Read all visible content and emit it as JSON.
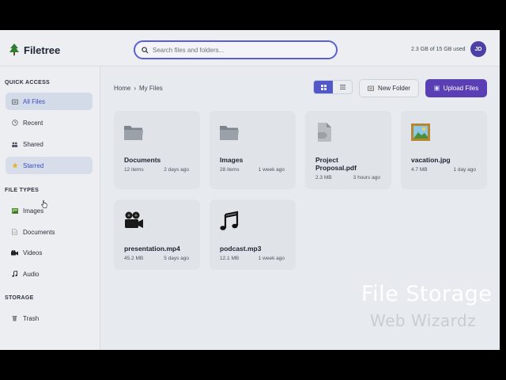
{
  "header": {
    "app_name": "Filetree",
    "search_placeholder": "Search files and folders...",
    "storage": "2.3 GB of 15 GB used",
    "avatar_initials": "JD"
  },
  "sidebar": {
    "quick_access_title": "QUICK ACCESS",
    "quick_access": [
      {
        "label": "All Files",
        "icon": "folder-icon",
        "state": "active"
      },
      {
        "label": "Recent",
        "icon": "clock-icon"
      },
      {
        "label": "Shared",
        "icon": "users-icon"
      },
      {
        "label": "Starred",
        "icon": "star-icon",
        "state": "hover"
      }
    ],
    "file_types_title": "FILE TYPES",
    "file_types": [
      {
        "label": "Images",
        "icon": "image-icon"
      },
      {
        "label": "Documents",
        "icon": "document-icon"
      },
      {
        "label": "Videos",
        "icon": "video-icon"
      },
      {
        "label": "Audio",
        "icon": "music-icon"
      }
    ],
    "storage_title": "STORAGE",
    "storage_items": [
      {
        "label": "Trash",
        "icon": "trash-icon"
      }
    ]
  },
  "toolbar": {
    "breadcrumb_home": "Home",
    "breadcrumb_sep": "›",
    "breadcrumb_current": "My Files",
    "view_mode": "grid",
    "new_folder_label": "New Folder",
    "upload_label": "Upload Files"
  },
  "files": [
    {
      "name": "Documents",
      "icon": "folder-icon",
      "size": "12 items",
      "date": "2 days ago"
    },
    {
      "name": "Images",
      "icon": "folder-icon",
      "size": "28 items",
      "date": "1 week ago"
    },
    {
      "name": "Project Proposal.pdf",
      "icon": "pdf-icon",
      "size": "2.3 MB",
      "date": "3 hours ago"
    },
    {
      "name": "vacation.jpg",
      "icon": "picture-icon",
      "size": "4.7 MB",
      "date": "1 day ago"
    },
    {
      "name": "presentation.mp4",
      "icon": "movie-camera-icon",
      "size": "45.2 MB",
      "date": "5 days ago"
    },
    {
      "name": "podcast.mp3",
      "icon": "music-note-icon",
      "size": "12.1 MB",
      "date": "1 week ago"
    }
  ],
  "watermark": {
    "title": "File Storage",
    "subtitle": "Web Wizardz"
  },
  "colors": {
    "accent": "#5b5fd6",
    "upload_button": "#5a3fb4",
    "active_nav_bg": "#d3dbe8"
  }
}
